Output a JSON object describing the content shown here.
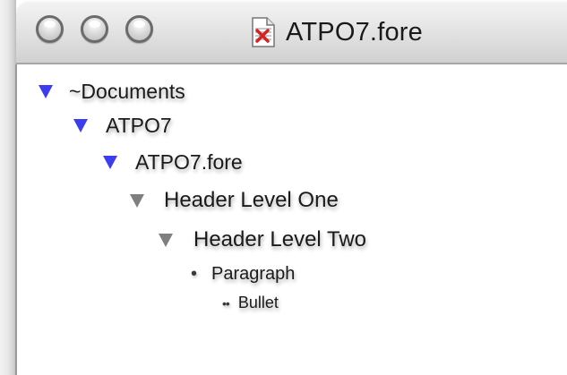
{
  "window": {
    "title": "ATPO7.fore",
    "document_icon": "document-icon"
  },
  "traffic_lights": [
    "close-button",
    "minimize-button",
    "zoom-button"
  ],
  "outline": [
    {
      "label": "~Documents",
      "marker": "expanded-triangle",
      "color": "#3d3df0"
    },
    {
      "label": "ATPO7",
      "marker": "expanded-triangle",
      "color": "#3d3df0"
    },
    {
      "label": "ATPO7.fore",
      "marker": "expanded-triangle",
      "color": "#3d3df0"
    },
    {
      "label": "Header Level One",
      "marker": "expanded-triangle",
      "color": "#7f7f7f"
    },
    {
      "label": "Header Level Two",
      "marker": "expanded-triangle",
      "color": "#7f7f7f"
    },
    {
      "label": "Paragraph",
      "marker": "•",
      "color": "#3a3a3a"
    },
    {
      "label": "Bullet",
      "marker": "••",
      "color": "#3a3a3a"
    }
  ]
}
